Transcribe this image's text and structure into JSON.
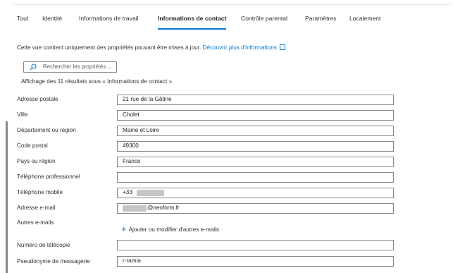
{
  "tabs": [
    {
      "label": "Tout"
    },
    {
      "label": "Identité"
    },
    {
      "label": "Informations de travail"
    },
    {
      "label": "Informations de contact"
    },
    {
      "label": "Contrôle parental"
    },
    {
      "label": "Paramètres"
    },
    {
      "label": "Localement"
    }
  ],
  "active_tab": "Informations de contact",
  "description": {
    "text": "Cette vue contient uniquement des propriétés pouvant être mises à jour.",
    "link": "Découvrir plus d'informations"
  },
  "search": {
    "placeholder": "Rechercher les propriétés ..."
  },
  "results_text": "Affichage des 11 résultats sous « Informations de contact »",
  "fields": {
    "postal_address": {
      "label": "Adresse postale",
      "value": "21 rue de la Gâtine"
    },
    "city": {
      "label": "Ville",
      "value": "Cholet"
    },
    "state": {
      "label": "Département ou région",
      "value": "Maine et Loire"
    },
    "postal_code": {
      "label": "Code postal",
      "value": "49300"
    },
    "country": {
      "label": "Pays ou région",
      "value": "France"
    },
    "business_phone": {
      "label": "Téléphone professionnel",
      "value": ""
    },
    "mobile_phone": {
      "label": "Téléphone mobile",
      "value": "+33"
    },
    "email": {
      "label": "Adresse e-mail",
      "value": "@neoform.fr"
    },
    "other_emails": {
      "label": "Autres e-mails",
      "action": "Ajouter ou modifier d'autres e-mails"
    },
    "fax": {
      "label": "Numéro de télécopie",
      "value": ""
    },
    "im_alias": {
      "label": "Pseudonyme de messagerie",
      "value": "r-ramia"
    }
  },
  "colors": {
    "accent": "#0078d4",
    "text": "#323130",
    "border": "#8a8886"
  },
  "icons": [
    "search-icon",
    "external-link-icon",
    "plus-icon"
  ]
}
